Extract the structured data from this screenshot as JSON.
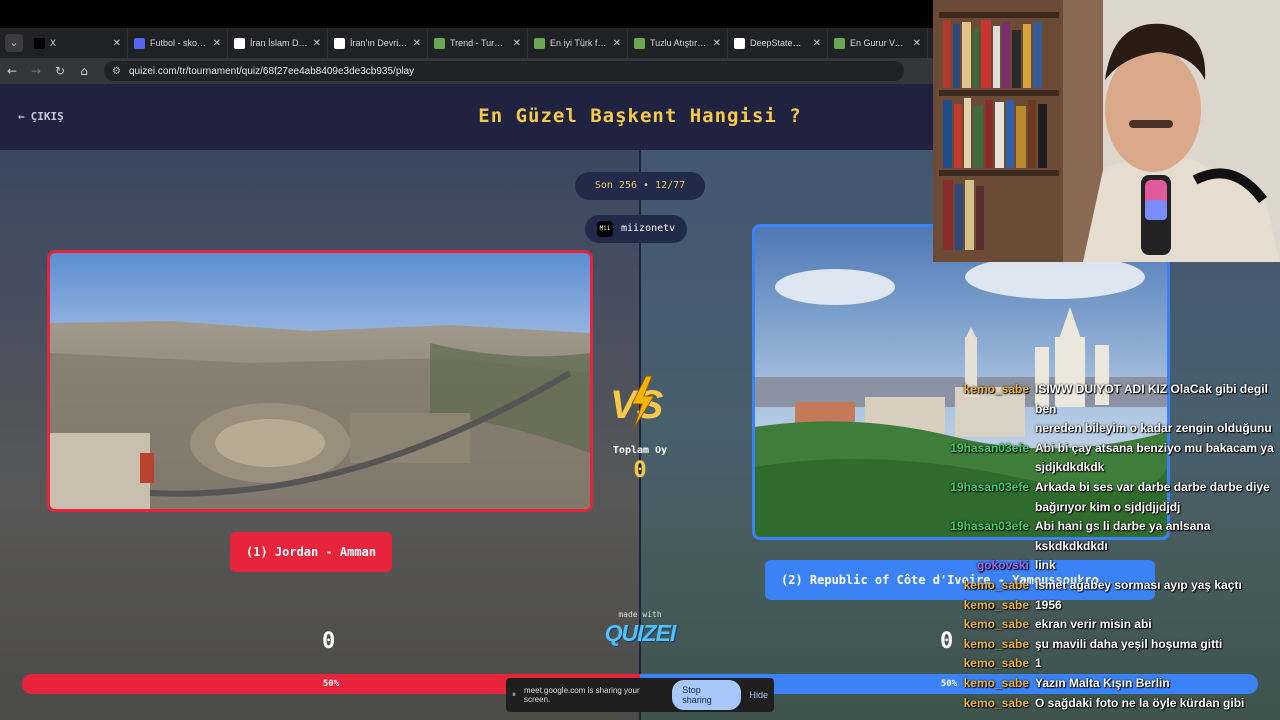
{
  "browser": {
    "tabs": [
      {
        "title": "X",
        "color": "#000000"
      },
      {
        "title": "Futbol - skorlar",
        "color": "#5865f2"
      },
      {
        "title": "İran İslam Devr",
        "color": "#ffffff"
      },
      {
        "title": "İran'ın Devrimi",
        "color": "#ffffff"
      },
      {
        "title": "Trend - Turnuv",
        "color": "#6aa84f"
      },
      {
        "title": "En iyi Türk filmi",
        "color": "#6aa84f"
      },
      {
        "title": "Tuzlu Atıştırma",
        "color": "#6aa84f"
      },
      {
        "title": "DeepStateMAP",
        "color": "#ffffff"
      },
      {
        "title": "En Gurur Verici",
        "color": "#6aa84f"
      }
    ],
    "url": "quizei.com/tr/tournament/quiz/68f27ee4ab8409e3de3cb935/play"
  },
  "quiz": {
    "exit_label": "ÇIKIŞ",
    "title": "En Güzel Başkent Hangisi ?",
    "round_info": "Son 256 • 12/77",
    "username": "miizonetv",
    "avatar_text": "Mii",
    "left": {
      "label": "(1) Jordan - Amman",
      "score": "0",
      "percent": "50%"
    },
    "right": {
      "label": "(2) Republic of Côte d'Ivoire - Yamoussoukro",
      "score": "0",
      "percent": "50%"
    },
    "total_label": "Toplam Oy",
    "total_value": "0",
    "made_with": "made with",
    "logo_text": "QUIZEI",
    "colors": {
      "left": "#e8233c",
      "right": "#3b82f6",
      "accent": "#f7c948"
    }
  },
  "screen_share": {
    "message": "meet.google.com is sharing your screen.",
    "stop_label": "Stop sharing",
    "hide_label": "Hide"
  },
  "chat": [
    {
      "user": "kemo_sabe",
      "color": "#e8b44a",
      "text": "ISIWW DUIYOT ADI KIZ OlaCak gibi degil ben"
    },
    {
      "user": "",
      "color": "#e8b44a",
      "text": "nereden bileyim o kadar zengin olduğunu"
    },
    {
      "user": "19hasan03efe",
      "color": "#3fcf6a",
      "text": "Abi bi çay atsana benziyo mu bakacam ya"
    },
    {
      "user": "",
      "color": "#3fcf6a",
      "text": "sjdjkdkdkdk"
    },
    {
      "user": "19hasan03efe",
      "color": "#3fcf6a",
      "text": "Arkada bi ses var darbe darbe darbe diye"
    },
    {
      "user": "",
      "color": "#3fcf6a",
      "text": "bağırıyor kim o sjdjdjjdjdj"
    },
    {
      "user": "19hasan03efe",
      "color": "#3fcf6a",
      "text": "Abi hani gs li darbe ya anlsana"
    },
    {
      "user": "",
      "color": "#3fcf6a",
      "text": "kskdkdkdkdı"
    },
    {
      "user": "gokovski",
      "color": "#9b6cf0",
      "text": "link"
    },
    {
      "user": "kemo_sabe",
      "color": "#e8b44a",
      "text": "İsmet ağabey sorması ayıp yaş kaçtı"
    },
    {
      "user": "kemo_sabe",
      "color": "#e8b44a",
      "text": "1956"
    },
    {
      "user": "kemo_sabe",
      "color": "#e8b44a",
      "text": "ekran verir misin abi"
    },
    {
      "user": "kemo_sabe",
      "color": "#e8b44a",
      "text": "şu mavili daha yeşil hoşuma gitti"
    },
    {
      "user": "kemo_sabe",
      "color": "#e8b44a",
      "text": "1"
    },
    {
      "user": "kemo_sabe",
      "color": "#e8b44a",
      "text": "Yazın Malta Kışın Berlin"
    },
    {
      "user": "kemo_sabe",
      "color": "#e8b44a",
      "text": "O sağdaki foto ne la öyle kürdan gibi"
    }
  ]
}
